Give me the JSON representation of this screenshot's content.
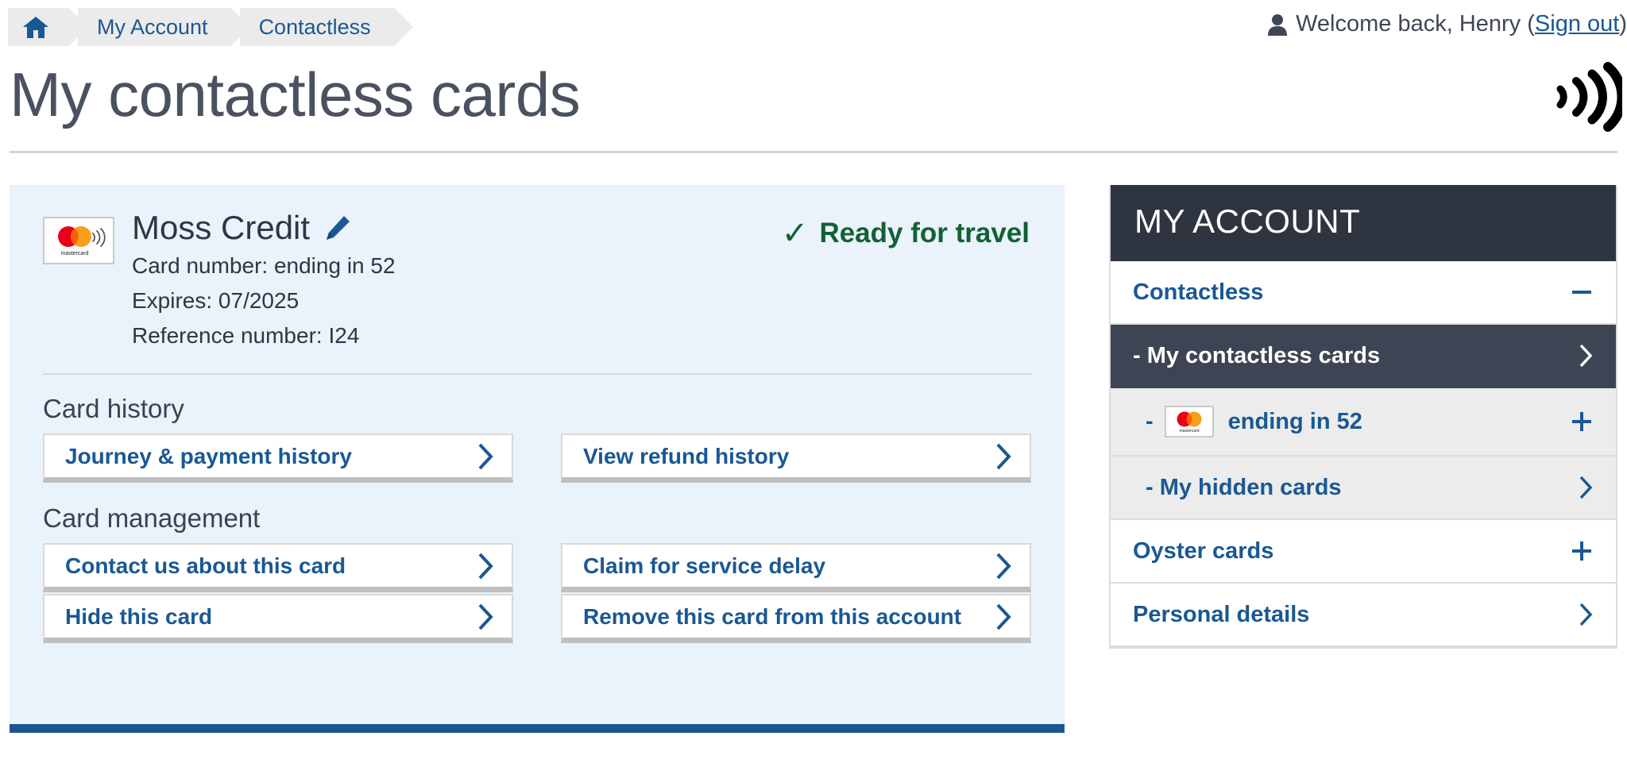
{
  "breadcrumb": {
    "home_icon": "home-icon",
    "items": [
      {
        "label": "My Account"
      },
      {
        "label": "Contactless"
      }
    ]
  },
  "header": {
    "welcome_prefix": "Welcome back, Henry (",
    "welcome_link": "Sign out",
    "welcome_suffix": ")",
    "user_icon": "person-icon",
    "page_title": "My contactless cards",
    "contactless_icon": "contactless-waves-icon"
  },
  "card": {
    "scheme_icon": "mastercard-contactless-icon",
    "scheme_name": "mastercard",
    "name": "Moss Credit",
    "edit_icon": "pencil-edit-icon",
    "card_number": "Card number: ending in 52",
    "expires": "Expires: 07/2025",
    "reference": "Reference number: I24",
    "status_icon": "check-icon",
    "status": "Ready for travel",
    "status_color": "#126133",
    "sections": [
      {
        "title": "Card history",
        "columns": [
          {
            "buttons": [
              {
                "label": "Journey & payment history",
                "icon": "chevron-right-icon"
              }
            ]
          },
          {
            "buttons": [
              {
                "label": "View refund history",
                "icon": "chevron-right-icon"
              }
            ]
          }
        ]
      },
      {
        "title": "Card management",
        "columns": [
          {
            "buttons": [
              {
                "label": "Contact us about this card",
                "icon": "chevron-right-icon"
              },
              {
                "label": "Hide this card",
                "icon": "chevron-right-icon"
              }
            ]
          },
          {
            "buttons": [
              {
                "label": "Claim for service delay",
                "icon": "chevron-right-icon"
              },
              {
                "label": "Remove this card from this account",
                "icon": "chevron-right-icon"
              }
            ]
          }
        ]
      }
    ]
  },
  "sidebar": {
    "title": "MY ACCOUNT",
    "items": [
      {
        "label": "Contactless",
        "sign": "–",
        "sign_icon": "minus-icon",
        "style": "top"
      },
      {
        "label": "- My contactless cards",
        "sign": "›",
        "sign_icon": "chevron-right-icon",
        "style": "active"
      },
      {
        "label": "ending in 52",
        "dash": "-",
        "sign": "+",
        "sign_icon": "plus-icon",
        "style": "sub-card",
        "scheme_icon": "mastercard-icon",
        "scheme_name": "mastercard"
      },
      {
        "label": "- My hidden cards",
        "sign": "›",
        "sign_icon": "chevron-right-icon",
        "style": "sub"
      },
      {
        "label": "Oyster cards",
        "sign": "+",
        "sign_icon": "plus-icon",
        "style": "top"
      },
      {
        "label": "Personal details",
        "sign": "›",
        "sign_icon": "chevron-right-icon",
        "style": "top"
      }
    ]
  },
  "colors": {
    "link_blue": "#1a5893",
    "panel_bg": "#eaf2fb",
    "panel_accent": "#1b5693",
    "sidebar_dark": "#2e3540",
    "sidebar_active": "#3d4453",
    "status_green": "#126133"
  }
}
